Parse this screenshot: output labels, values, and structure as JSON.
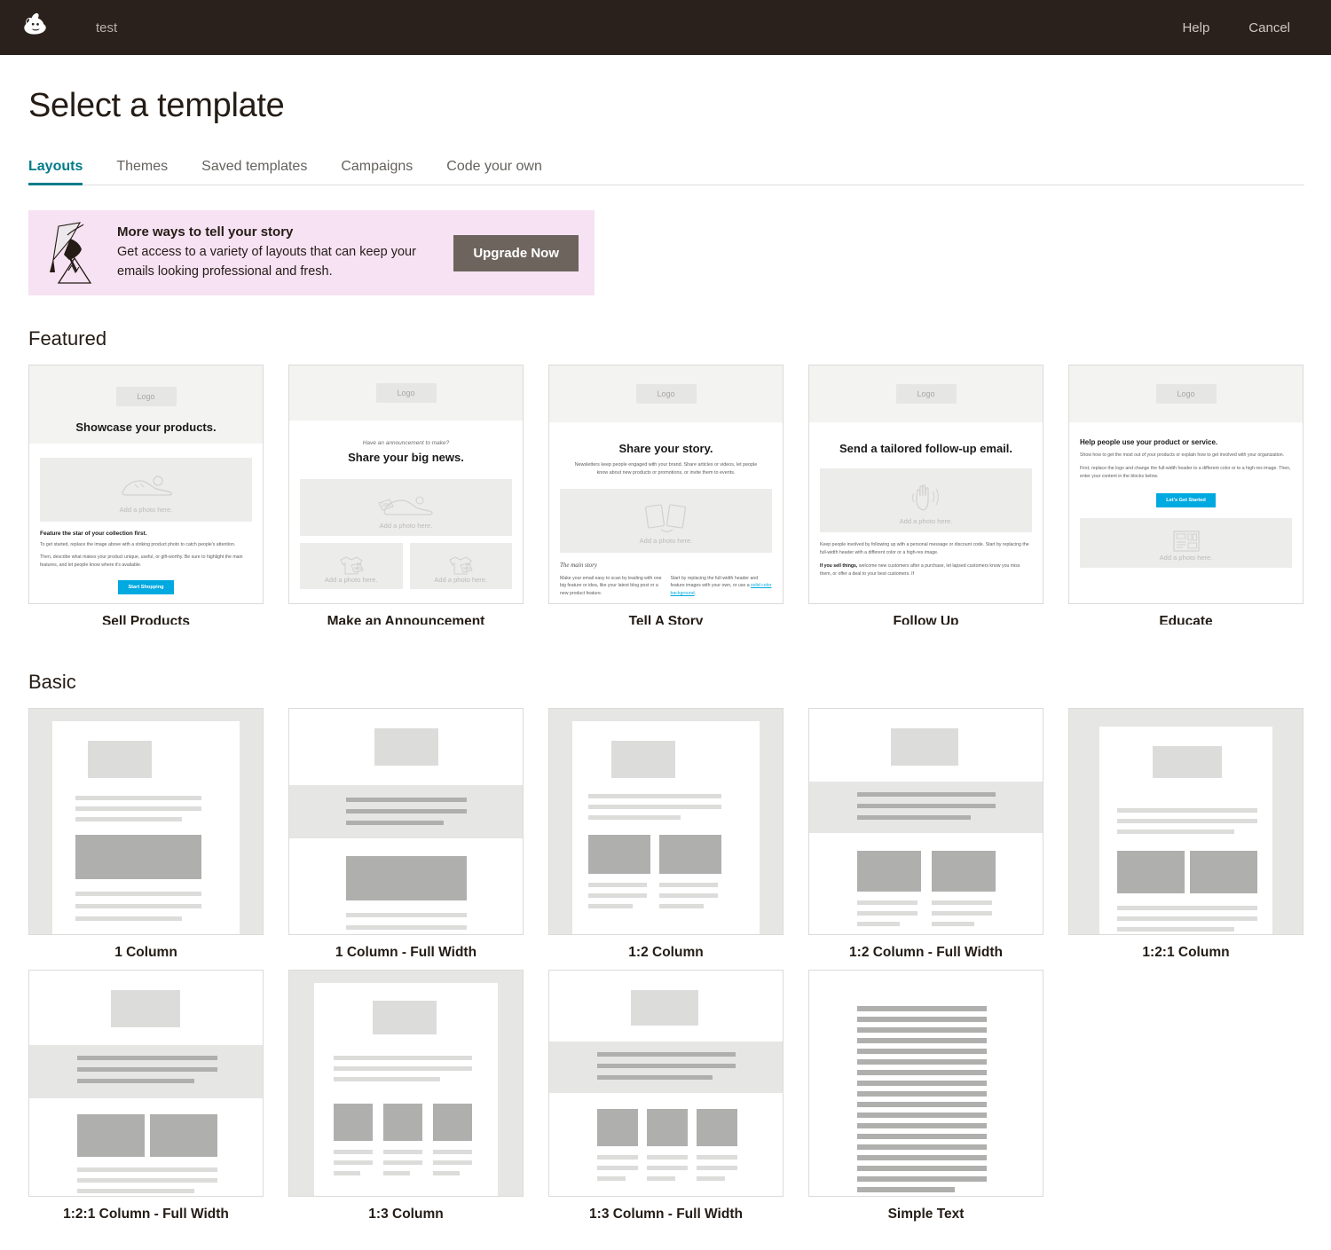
{
  "topbar": {
    "logo_name": "mailchimp-freddie-logo",
    "project_name": "test",
    "help_label": "Help",
    "cancel_label": "Cancel",
    "background_color": "#2A211C"
  },
  "page": {
    "title": "Select a template"
  },
  "tabs": [
    {
      "label": "Layouts",
      "active": true
    },
    {
      "label": "Themes",
      "active": false
    },
    {
      "label": "Saved templates",
      "active": false
    },
    {
      "label": "Campaigns",
      "active": false
    },
    {
      "label": "Code your own",
      "active": false
    }
  ],
  "tabs_active_color": "#007C89",
  "promo": {
    "title": "More ways to tell your story",
    "body": "Get access to a variety of layouts that can keep your emails looking professional and fresh.",
    "button_label": "Upgrade Now",
    "background_color": "#F6E2F3",
    "button_color": "#6E645E"
  },
  "featured": {
    "heading": "Featured",
    "cards": [
      {
        "label": "Sell Products",
        "logo_text": "Logo",
        "headline": "Showcase your products.",
        "photo_caption": "Add a photo here.",
        "subhead": "Feature the star of your collection first.",
        "para1": "To get started, replace the image above with a striking product photo to catch people's attention.",
        "para2": "Then, describe what makes your product unique, useful, or gift-worthy. Be sure to highlight the main features, and let people know where it's available.",
        "button_label": "Start Shopping",
        "button_color": "#00A9E0"
      },
      {
        "label": "Make an Announcement",
        "logo_text": "Logo",
        "kicker": "Have an announcement to make?",
        "headline": "Share your big news.",
        "photo_caption": "Add a photo here.",
        "photo_caption_left": "Add a photo here.",
        "photo_caption_right": "Add a photo here."
      },
      {
        "label": "Tell A Story",
        "logo_text": "Logo",
        "headline": "Share your story.",
        "intro": "Newsletters keep people engaged with your brand. Share articles or videos, let people know about new products or promotions, or invite them to events.",
        "photo_caption": "Add a photo here.",
        "section_title": "The main story",
        "col_left": "Make your email easy to scan by leading with one big feature or idea, like your latest blog post or a new product feature.",
        "col_right_pre": "Start by replacing the full-width header and feature images with your own, or use a ",
        "col_right_link": "solid color background",
        "col_right_post": "."
      },
      {
        "label": "Follow Up",
        "logo_text": "Logo",
        "headline": "Send a tailored follow-up email.",
        "photo_caption": "Add a photo here.",
        "para1": "Keep people involved by following up with a personal message or discount code. Start by replacing the full-width header with a different color or a high-res image.",
        "para2_bold": "If you sell things,",
        "para2": " welcome new customers after a purchase, let lapsed customers know you miss them, or offer a deal to your best customers. If"
      },
      {
        "label": "Educate",
        "logo_text": "Logo",
        "headline": "Help people use your product or service.",
        "para1": "Show how to get the most out of your products or explain how to get involved with your organization.",
        "para2": "First, replace the logo and change the full-width header to a different color or to a high-res image. Then, enter your content in the blocks below.",
        "button_label": "Let's Get Started",
        "button_color": "#00A9E0",
        "photo_caption": "Add a photo here."
      }
    ]
  },
  "basic": {
    "heading": "Basic",
    "cards": [
      {
        "label": "1 Column",
        "layout": "one-col",
        "full_width": false
      },
      {
        "label": "1 Column - Full Width",
        "layout": "one-col",
        "full_width": true
      },
      {
        "label": "1:2 Column",
        "layout": "two-col",
        "full_width": false
      },
      {
        "label": "1:2 Column - Full Width",
        "layout": "two-col",
        "full_width": true
      },
      {
        "label": "1:2:1 Column",
        "layout": "two-col-uneven",
        "full_width": false
      },
      {
        "label": "1:2:1 Column - Full Width",
        "layout": "two-col-uneven",
        "full_width": true
      },
      {
        "label": "1:3 Column",
        "layout": "three-col",
        "full_width": false
      },
      {
        "label": "1:3 Column - Full Width",
        "layout": "three-col",
        "full_width": true
      },
      {
        "label": "Simple Text",
        "layout": "simple-text",
        "full_width": false
      }
    ]
  }
}
